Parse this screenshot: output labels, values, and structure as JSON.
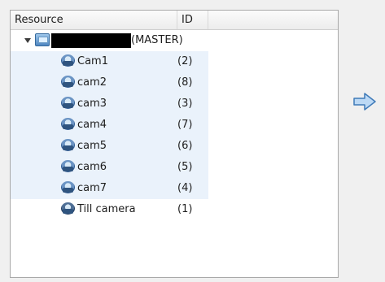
{
  "table": {
    "headers": {
      "resource": "Resource",
      "id": "ID"
    },
    "server": {
      "suffix": "(MASTER)"
    },
    "cameras": [
      {
        "name": "Cam1",
        "id": "(2)"
      },
      {
        "name": "cam2",
        "id": "(8)"
      },
      {
        "name": "cam3",
        "id": "(3)"
      },
      {
        "name": "cam4",
        "id": "(7)"
      },
      {
        "name": "cam5",
        "id": "(6)"
      },
      {
        "name": "cam6",
        "id": "(5)"
      },
      {
        "name": "cam7",
        "id": "(4)"
      },
      {
        "name": "Till camera",
        "id": "(1)"
      }
    ]
  },
  "icons": {
    "expander": "triangle-down-icon",
    "server": "server-icon",
    "camera": "camera-icon",
    "arrow": "arrow-right-icon"
  },
  "colors": {
    "arrow_fill": "#bcd9f5",
    "arrow_stroke": "#3f7ab8",
    "selected_row": "#eaf2fb"
  }
}
